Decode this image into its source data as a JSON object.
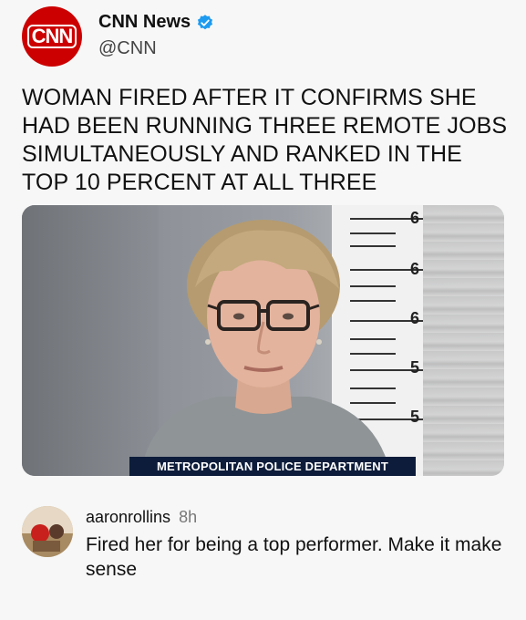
{
  "post": {
    "account_name": "CNN News",
    "handle": "@CNN",
    "logo_text": "CNN",
    "verified_icon": "verified-badge-icon",
    "headline": "WOMAN FIRED AFTER IT CONFIRMS SHE HAD BEEN RUNNING THREE REMOTE JOBS SIMULTANEOUSLY AND RANKED IN THE TOP 10 PERCENT AT ALL THREE",
    "image": {
      "caption": "METROPOLITAN POLICE DEPARTMENT",
      "height_marks": [
        "6",
        "6",
        "6",
        "5",
        "5"
      ]
    }
  },
  "comment": {
    "username": "aaronrollins",
    "time": "8h",
    "text": "Fired her for being a top performer. Make it make sense"
  },
  "colors": {
    "brand_red": "#cc0000",
    "verified_blue": "#1d9bf0",
    "caption_bg": "#0d1c3a"
  }
}
